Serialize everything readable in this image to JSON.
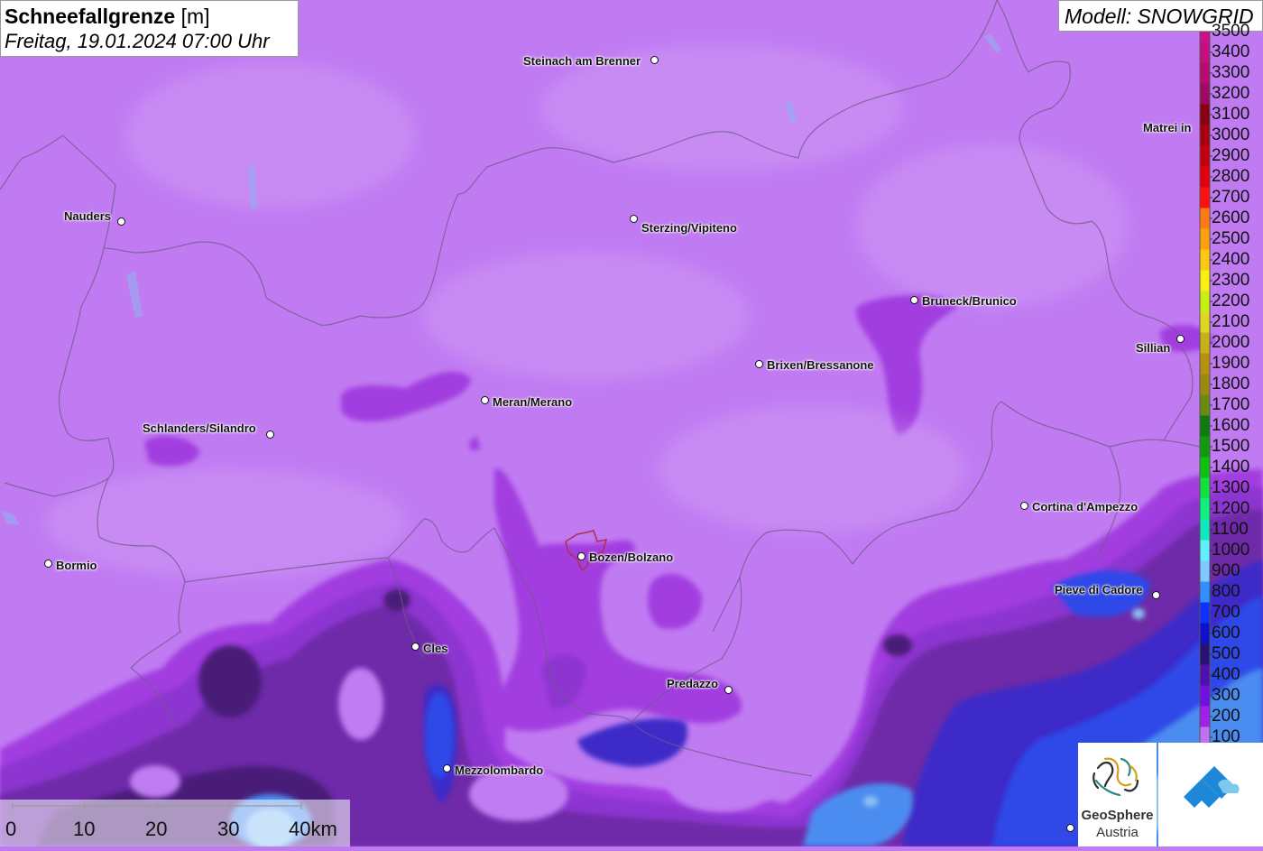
{
  "header": {
    "title": "Schneefallgrenze",
    "unit": "[m]",
    "datetime": "Freitag, 19.01.2024 07:00 Uhr"
  },
  "model": {
    "label": "Modell: SNOWGRID"
  },
  "legend": {
    "items": [
      {
        "label": "3500",
        "color": "#d0108a"
      },
      {
        "label": "3400",
        "color": "#c50e80"
      },
      {
        "label": "3300",
        "color": "#b80b72"
      },
      {
        "label": "3200",
        "color": "#a00865"
      },
      {
        "label": "3100",
        "color": "#8a0010"
      },
      {
        "label": "3000",
        "color": "#a80010"
      },
      {
        "label": "2900",
        "color": "#c20010"
      },
      {
        "label": "2800",
        "color": "#e00010"
      },
      {
        "label": "2700",
        "color": "#ff1010"
      },
      {
        "label": "2600",
        "color": "#ff7a10"
      },
      {
        "label": "2500",
        "color": "#ffa010"
      },
      {
        "label": "2400",
        "color": "#ffc810"
      },
      {
        "label": "2300",
        "color": "#f8f010"
      },
      {
        "label": "2200",
        "color": "#c8f010"
      },
      {
        "label": "2100",
        "color": "#e0d820"
      },
      {
        "label": "2000",
        "color": "#c8b018"
      },
      {
        "label": "1900",
        "color": "#b89010"
      },
      {
        "label": "1800",
        "color": "#9a8a10"
      },
      {
        "label": "1700",
        "color": "#6a8a10"
      },
      {
        "label": "1600",
        "color": "#107a10"
      },
      {
        "label": "1500",
        "color": "#109a10"
      },
      {
        "label": "1400",
        "color": "#10c010"
      },
      {
        "label": "1300",
        "color": "#10e040"
      },
      {
        "label": "1200",
        "color": "#10f080"
      },
      {
        "label": "1100",
        "color": "#10e8c0"
      },
      {
        "label": "1000",
        "color": "#60f0ff"
      },
      {
        "label": "900",
        "color": "#80c8ff"
      },
      {
        "label": "800",
        "color": "#3090ff"
      },
      {
        "label": "700",
        "color": "#1030ff"
      },
      {
        "label": "600",
        "color": "#1010c8"
      },
      {
        "label": "500",
        "color": "#2a1070"
      },
      {
        "label": "400",
        "color": "#5010b0"
      },
      {
        "label": "300",
        "color": "#7010e0"
      },
      {
        "label": "200",
        "color": "#a020e8"
      },
      {
        "label": "100",
        "color": "#c070f0"
      }
    ]
  },
  "places": [
    {
      "name": "Steinach am Brenner"
    },
    {
      "name": "Nauders"
    },
    {
      "name": "Sterzing/Vipiteno"
    },
    {
      "name": "Matrei in"
    },
    {
      "name": "Bruneck/Brunico"
    },
    {
      "name": "Sillian"
    },
    {
      "name": "Brixen/Bressanone"
    },
    {
      "name": "Meran/Merano"
    },
    {
      "name": "Schlanders/Silandro"
    },
    {
      "name": "Cortina d'Ampezzo"
    },
    {
      "name": "Bormio"
    },
    {
      "name": "Bozen/Bolzano"
    },
    {
      "name": "Pieve di Cadore"
    },
    {
      "name": "Cles"
    },
    {
      "name": "Predazzo"
    },
    {
      "name": "Mezzolombardo"
    }
  ],
  "scale_bar": {
    "ticks": [
      "0",
      "10",
      "20",
      "30",
      "40km"
    ]
  },
  "logos": {
    "geosphere_line1": "GeoSphere",
    "geosphere_line2": "Austria"
  },
  "colors": {
    "base_snowline": "#c07bf2",
    "zone_200": "#a23ee0",
    "zone_300": "#8d35d0",
    "zone_400": "#6e2aa8",
    "zone_500": "#4a1f78",
    "zone_600": "#3c2cc8",
    "zone_700": "#2e48e8",
    "zone_800": "#4c8cf0",
    "zone_900": "#8ac2f4",
    "border": "#6e5a88",
    "bolzano_outline": "#b03050"
  }
}
